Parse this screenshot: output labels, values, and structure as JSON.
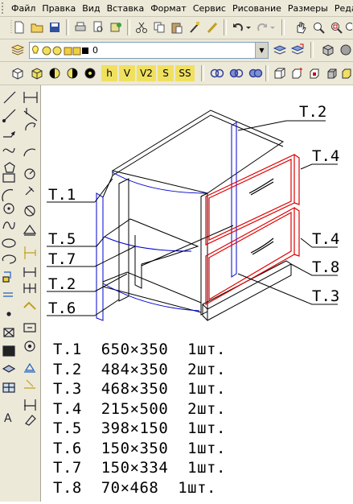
{
  "menu": {
    "items": [
      "Файл",
      "Правка",
      "Вид",
      "Вставка",
      "Формат",
      "Сервис",
      "Рисование",
      "Размеры",
      "Реда"
    ]
  },
  "layer_toolbar": {
    "current_layer": "0"
  },
  "view_toolbar": {
    "labels": [
      "h",
      "V",
      "V2",
      "S",
      "SS"
    ]
  },
  "drawing": {
    "callouts": {
      "t1": "Т.1",
      "t2_top": "Т.2",
      "t2_left": "Т.2",
      "t3": "Т.3",
      "t4_upper": "Т.4",
      "t4_lower": "Т.4",
      "t5": "Т.5",
      "t6": "Т.6",
      "t7": "Т.7",
      "t8": "Т.8"
    },
    "parts_list": [
      "Т.1  650×350  1шт.",
      "Т.2  484×350  2шт.",
      "Т.3  468×350  1шт.",
      "Т.4  215×500  2шт.",
      "Т.5  398×150  1шт.",
      "Т.6  150×350  1шт.",
      "Т.7  150×334  1шт.",
      "Т.8  70×468  1шт."
    ]
  },
  "colors": {
    "ui_bg": "#ece9d8",
    "drawing_line": "#000000",
    "panel_edge": "#0000cc",
    "drawer_front": "#e00000"
  }
}
